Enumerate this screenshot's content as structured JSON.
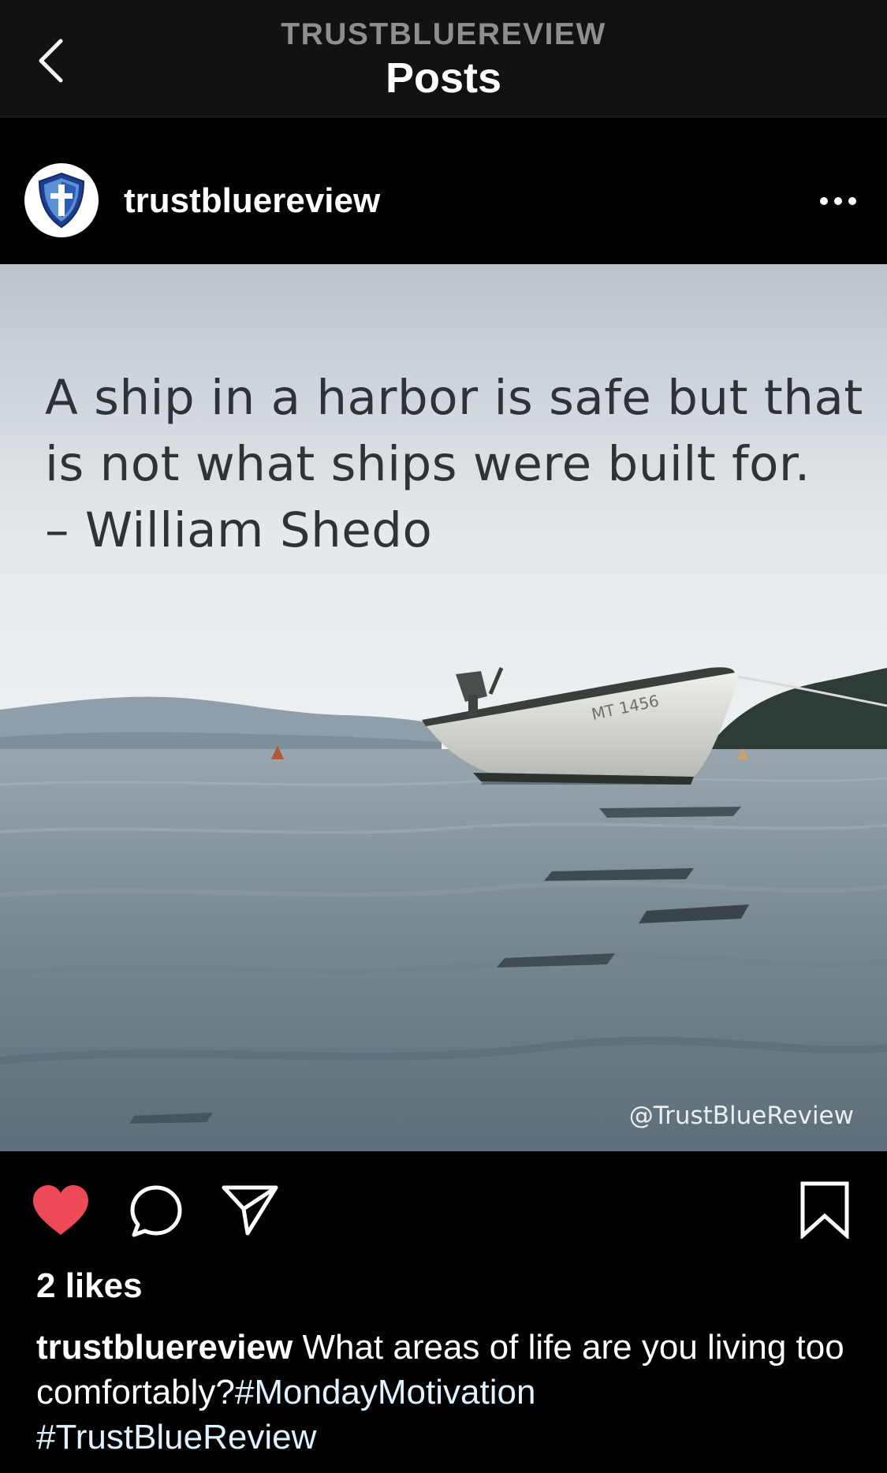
{
  "header": {
    "account": "TRUSTBLUEREVIEW",
    "title": "Posts"
  },
  "post": {
    "username": "trustbluereview",
    "avatar_icon": "shield-cross-icon",
    "image": {
      "quote_lines": [
        "A ship in a harbor is safe but that",
        "is not what ships were built for.",
        "– William Shedo"
      ],
      "boat_label": "MT 1456",
      "watermark": "@TrustBlueReview"
    },
    "actions": {
      "like_icon": "heart-filled-icon",
      "comment_icon": "comment-icon",
      "share_icon": "send-icon",
      "save_icon": "bookmark-icon",
      "like_color": "#ed4956"
    },
    "likes": "2 likes",
    "caption": {
      "username": "trustbluereview",
      "text_before": " What areas of life are you living too comfortably?",
      "tags": [
        "#MondayMotivation",
        "#TrustBlueReview"
      ]
    }
  }
}
